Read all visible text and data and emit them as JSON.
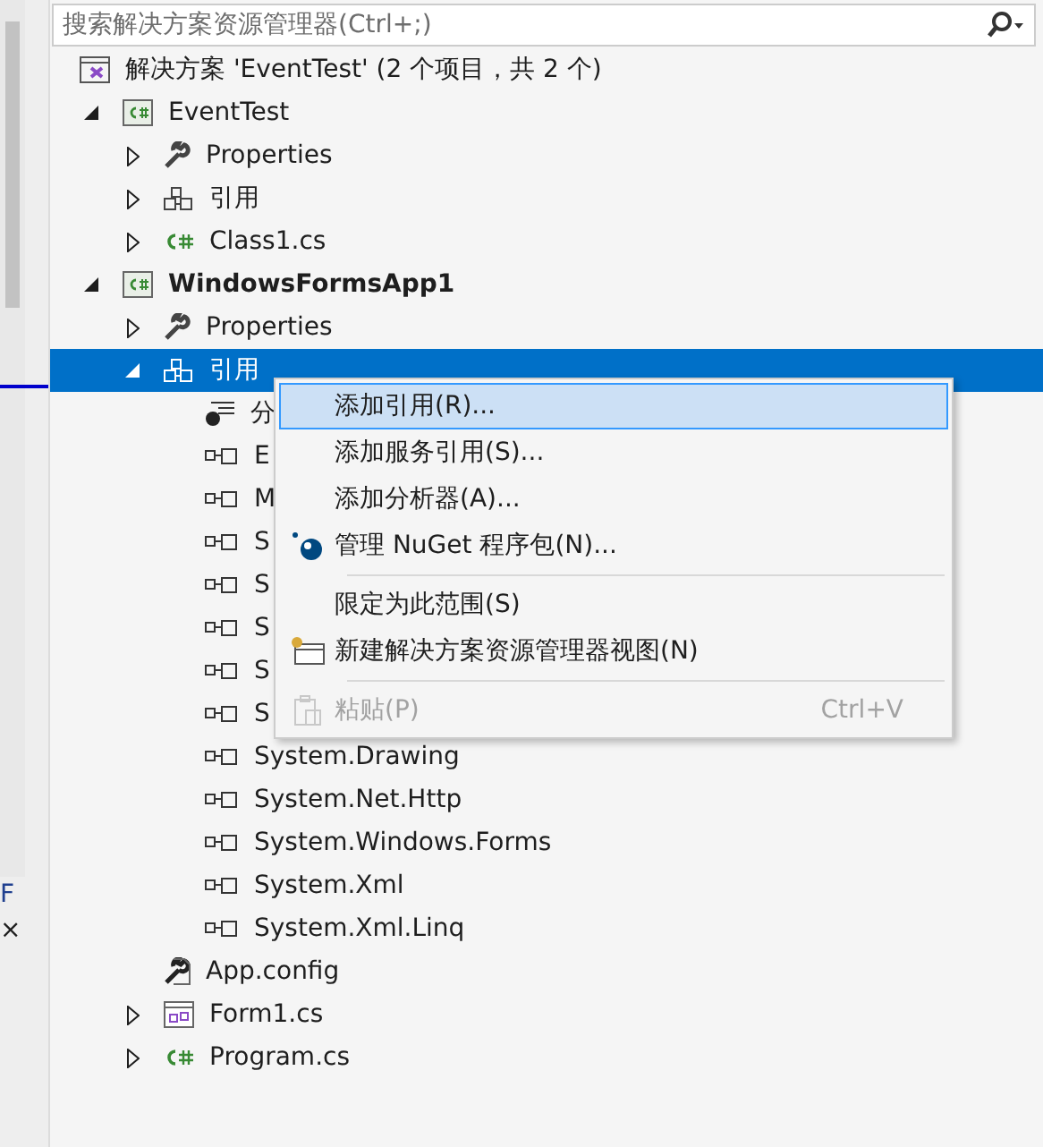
{
  "side_panel": {
    "texts": [
      "F",
      "×"
    ]
  },
  "search": {
    "placeholder": "搜索解决方案资源管理器(Ctrl+;)"
  },
  "tree": [
    {
      "kind": "solution",
      "label": "解决方案 'EventTest' (2 个项目，共 2 个)",
      "selected": false,
      "children": [
        {
          "kind": "project",
          "label": "EventTest",
          "expanded": true,
          "startup": false,
          "selected": false,
          "children": [
            {
              "kind": "properties",
              "label": "Properties",
              "expanded": false,
              "selected": false
            },
            {
              "kind": "references",
              "label": "引用",
              "expanded": false,
              "selected": false
            },
            {
              "kind": "csfile",
              "label": "Class1.cs",
              "expanded": false,
              "selected": false
            }
          ]
        },
        {
          "kind": "project",
          "label": "WindowsFormsApp1",
          "expanded": true,
          "startup": true,
          "selected": false,
          "children": [
            {
              "kind": "properties",
              "label": "Properties",
              "expanded": false,
              "selected": false
            },
            {
              "kind": "references",
              "label": "引用",
              "expanded": true,
              "selected": true,
              "children": [
                {
                  "kind": "analyzers",
                  "label": "分",
                  "selected": false
                },
                {
                  "kind": "reference",
                  "label": "E",
                  "selected": false
                },
                {
                  "kind": "reference",
                  "label": "M",
                  "selected": false
                },
                {
                  "kind": "reference",
                  "label": "S",
                  "selected": false
                },
                {
                  "kind": "reference",
                  "label": "S",
                  "selected": false
                },
                {
                  "kind": "reference",
                  "label": "S",
                  "selected": false
                },
                {
                  "kind": "reference",
                  "label": "S",
                  "selected": false
                },
                {
                  "kind": "reference",
                  "label": "S",
                  "selected": false
                },
                {
                  "kind": "reference",
                  "label": "System.Drawing",
                  "selected": false
                },
                {
                  "kind": "reference",
                  "label": "System.Net.Http",
                  "selected": false
                },
                {
                  "kind": "reference",
                  "label": "System.Windows.Forms",
                  "selected": false
                },
                {
                  "kind": "reference",
                  "label": "System.Xml",
                  "selected": false
                },
                {
                  "kind": "reference",
                  "label": "System.Xml.Linq",
                  "selected": false
                }
              ]
            },
            {
              "kind": "config",
              "label": "App.config",
              "selected": false
            },
            {
              "kind": "form",
              "label": "Form1.cs",
              "expanded": false,
              "selected": false
            },
            {
              "kind": "csfile",
              "label": "Program.cs",
              "expanded": false,
              "selected": false
            }
          ]
        }
      ]
    }
  ],
  "context_menu": [
    {
      "kind": "command",
      "label": "添加引用(R)...",
      "selected": true,
      "disabled": false
    },
    {
      "kind": "command",
      "label": "添加服务引用(S)...",
      "selected": false,
      "disabled": false
    },
    {
      "kind": "command",
      "label": "添加分析器(A)...",
      "selected": false,
      "disabled": false
    },
    {
      "kind": "package",
      "label": "管理 NuGet 程序包(N)...",
      "selected": false,
      "disabled": false
    },
    {
      "kind": "separator"
    },
    {
      "kind": "command",
      "label": "限定为此范围(S)",
      "selected": false,
      "disabled": false
    },
    {
      "kind": "view",
      "label": "新建解决方案资源管理器视图(N)",
      "selected": false,
      "disabled": false
    },
    {
      "kind": "separator"
    },
    {
      "kind": "paste",
      "label": "粘贴(P)",
      "shortcut": "Ctrl+V",
      "selected": false,
      "disabled": true
    }
  ]
}
